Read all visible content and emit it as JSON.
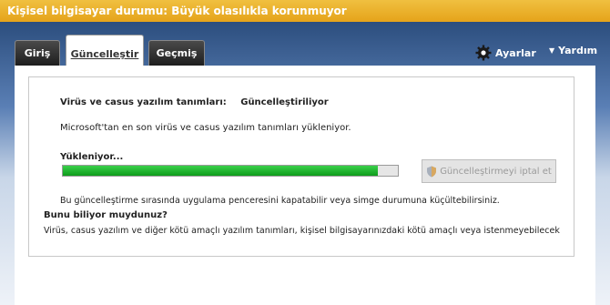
{
  "window": {
    "title": "Kişisel bilgisayar durumu: Büyük olasılıkla korunmuyor",
    "accent": "#e8a820"
  },
  "tabs": [
    {
      "label": "Giriş"
    },
    {
      "label": "Güncelleştir",
      "active": true
    },
    {
      "label": "Geçmiş"
    }
  ],
  "toolbar": {
    "settings_label": "Ayarlar",
    "help_label": "Yardım"
  },
  "update": {
    "status_label": "Virüs ve casus yazılım tanımları:",
    "status_value": "Güncelleştiriliyor",
    "description": "Microsoft'tan en son virüs ve casus yazılım tanımları yükleniyor.",
    "loading_label": "Yükleniyor...",
    "progress": 0.94,
    "progress_color": "#1db42a",
    "cancel_label": "Güncelleştirmeyi iptal et",
    "note": "Bu güncelleştirme sırasında uygulama penceresini kapatabilir veya simge durumuna küçültebilirsiniz."
  },
  "did_you_know": {
    "title": "Bunu biliyor muydunuz?",
    "text": "Virüs, casus yazılım ve diğer kötü amaçlı yazılım tanımları, kişisel bilgisayarınızdaki kötü amaçlı veya istenmeyebilecek"
  }
}
